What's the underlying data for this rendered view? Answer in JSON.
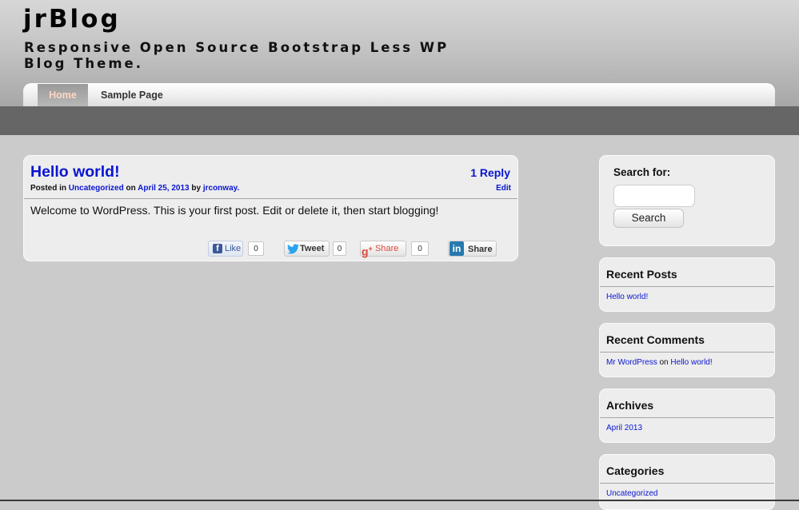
{
  "site": {
    "title": "jrBlog",
    "description": "Responsive Open Source Bootstrap Less WP Blog Theme."
  },
  "nav": {
    "items": [
      {
        "label": "Home",
        "active": true
      },
      {
        "label": "Sample Page",
        "active": false
      }
    ]
  },
  "post": {
    "title": "Hello world!",
    "reply_label": "1 Reply",
    "meta": {
      "posted_in_label": "Posted in",
      "category": "Uncategorized",
      "on_label": "on",
      "date": "April 25, 2013",
      "by_label": "by",
      "author": "jrconway."
    },
    "edit_label": "Edit",
    "content": "Welcome to WordPress. This is your first post. Edit or delete it, then start blogging!",
    "share": {
      "facebook": {
        "label": "Like",
        "count": "0",
        "icon": "facebook-icon"
      },
      "twitter": {
        "label": "Tweet",
        "count": "0",
        "icon": "twitter-bird-icon"
      },
      "googleplus": {
        "label": "Share",
        "count": "0",
        "icon": "google-plus-icon"
      },
      "linkedin": {
        "label": "Share",
        "icon": "linkedin-icon"
      }
    }
  },
  "sidebar": {
    "search": {
      "label": "Search for:",
      "value": "",
      "button_label": "Search"
    },
    "recent_posts": {
      "title": "Recent Posts",
      "items": [
        "Hello world!"
      ]
    },
    "recent_comments": {
      "title": "Recent Comments",
      "items": [
        {
          "author": "Mr WordPress",
          "on_label": "on",
          "post": "Hello world!"
        }
      ]
    },
    "archives": {
      "title": "Archives",
      "items": [
        "April 2013"
      ]
    },
    "categories": {
      "title": "Categories",
      "items": [
        "Uncategorized"
      ]
    }
  },
  "colors": {
    "link": "#0a16d0",
    "background": "#cbcbcb",
    "card": "#ededed",
    "subbar": "#666666",
    "nav_active_text": "#ffd6c2"
  }
}
